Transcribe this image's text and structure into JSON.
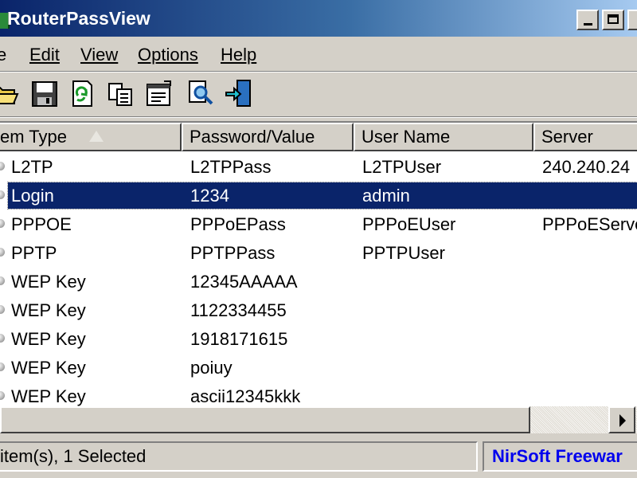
{
  "window": {
    "title": "RouterPassView"
  },
  "menu": {
    "items": [
      {
        "label": "e"
      },
      {
        "label": "Edit"
      },
      {
        "label": "View"
      },
      {
        "label": "Options"
      },
      {
        "label": "Help"
      }
    ]
  },
  "toolbar": {
    "buttons": [
      {
        "icon": "open-folder-icon"
      },
      {
        "icon": "save-icon"
      },
      {
        "icon": "refresh-icon"
      },
      {
        "icon": "copy-icon"
      },
      {
        "icon": "properties-icon"
      },
      {
        "icon": "find-icon"
      },
      {
        "icon": "exit-icon"
      }
    ]
  },
  "list": {
    "columns": [
      "em Type",
      "Password/Value",
      "User Name",
      "Server"
    ],
    "sort_column": 0,
    "rows": [
      {
        "type": "L2TP",
        "value": "L2TPPass",
        "user": "L2TPUser",
        "server": "240.240.24",
        "selected": false
      },
      {
        "type": "Login",
        "value": "1234",
        "user": "admin",
        "server": "",
        "selected": true
      },
      {
        "type": "PPPOE",
        "value": "PPPoEPass",
        "user": "PPPoEUser",
        "server": "PPPoEServe",
        "selected": false
      },
      {
        "type": "PPTP",
        "value": "PPTPPass",
        "user": "PPTPUser",
        "server": "",
        "selected": false
      },
      {
        "type": "WEP Key",
        "value": "12345AAAAA",
        "user": "",
        "server": "",
        "selected": false
      },
      {
        "type": "WEP Key",
        "value": "1122334455",
        "user": "",
        "server": "",
        "selected": false
      },
      {
        "type": "WEP Key",
        "value": "1918171615",
        "user": "",
        "server": "",
        "selected": false
      },
      {
        "type": "WEP Key",
        "value": "poiuy",
        "user": "",
        "server": "",
        "selected": false
      },
      {
        "type": "WEP Key",
        "value": "ascii12345kkk",
        "user": "",
        "server": "",
        "selected": false
      }
    ]
  },
  "status": {
    "count_text": "item(s), 1 Selected",
    "link_text": "NirSoft Freewar"
  },
  "colors": {
    "selection": "#0a246a",
    "link": "#0000ee",
    "titlebar_start": "#0a246a",
    "titlebar_end": "#a6caf0"
  }
}
